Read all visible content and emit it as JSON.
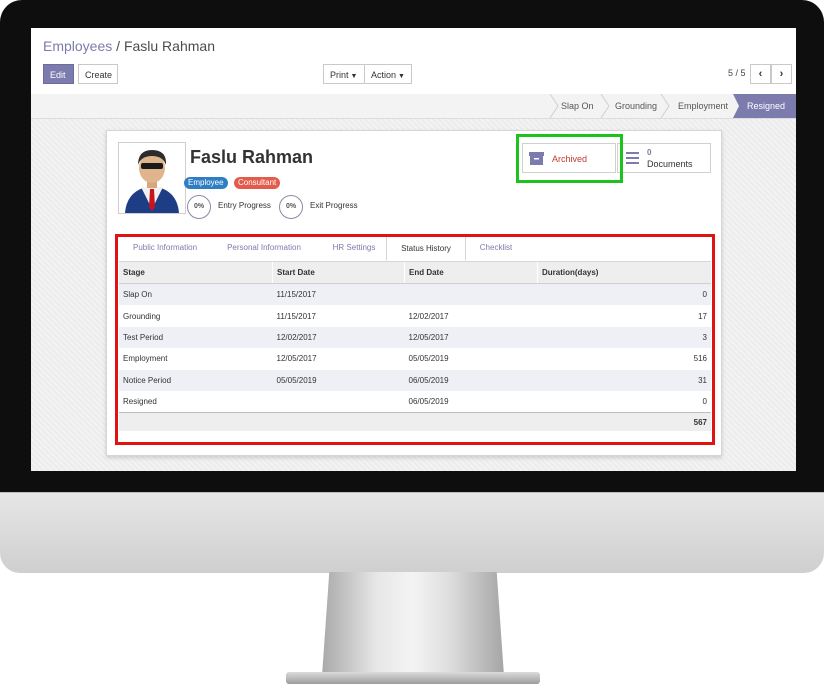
{
  "breadcrumb": {
    "parent": "Employees",
    "separator": "/",
    "current": "Faslu Rahman"
  },
  "toolbar": {
    "edit": "Edit",
    "create": "Create",
    "print": "Print",
    "action": "Action"
  },
  "pager": {
    "value": "5 / 5"
  },
  "stages": [
    {
      "label": "Slap On",
      "active": false
    },
    {
      "label": "Grounding",
      "active": false
    },
    {
      "label": "Employment",
      "active": false
    },
    {
      "label": "Resigned",
      "active": true
    }
  ],
  "employee": {
    "name": "Faslu Rahman",
    "tags": [
      {
        "label": "Employee",
        "color": "#2f7ec4"
      },
      {
        "label": "Consultant",
        "color": "#e35b4a"
      }
    ],
    "entry_progress": {
      "value": "0%",
      "label": "Entry Progress"
    },
    "exit_progress": {
      "value": "0%",
      "label": "Exit Progress"
    }
  },
  "smart_buttons": {
    "archived": {
      "label": "Archived",
      "icon": "archive-icon"
    },
    "documents": {
      "count": "0",
      "label": "Documents",
      "icon": "list-icon"
    }
  },
  "tabs": [
    {
      "label": "Public Information",
      "active": false
    },
    {
      "label": "Personal Information",
      "active": false
    },
    {
      "label": "HR Settings",
      "active": false
    },
    {
      "label": "Status History",
      "active": true
    },
    {
      "label": "Checklist",
      "active": false
    }
  ],
  "history": {
    "columns": [
      "Stage",
      "Start Date",
      "End Date",
      "Duration(days)"
    ],
    "rows": [
      [
        "Slap On",
        "11/15/2017",
        "",
        "0"
      ],
      [
        "Grounding",
        "11/15/2017",
        "12/02/2017",
        "17"
      ],
      [
        "Test Period",
        "12/02/2017",
        "12/05/2017",
        "3"
      ],
      [
        "Employment",
        "12/05/2017",
        "05/05/2019",
        "516"
      ],
      [
        "Notice Period",
        "05/05/2019",
        "06/05/2019",
        "31"
      ],
      [
        "Resigned",
        "",
        "06/05/2019",
        "0"
      ]
    ],
    "total": "567"
  },
  "colors": {
    "accent": "#7c7bad",
    "highlight_green": "#1ec21e",
    "highlight_red": "#e01313"
  }
}
